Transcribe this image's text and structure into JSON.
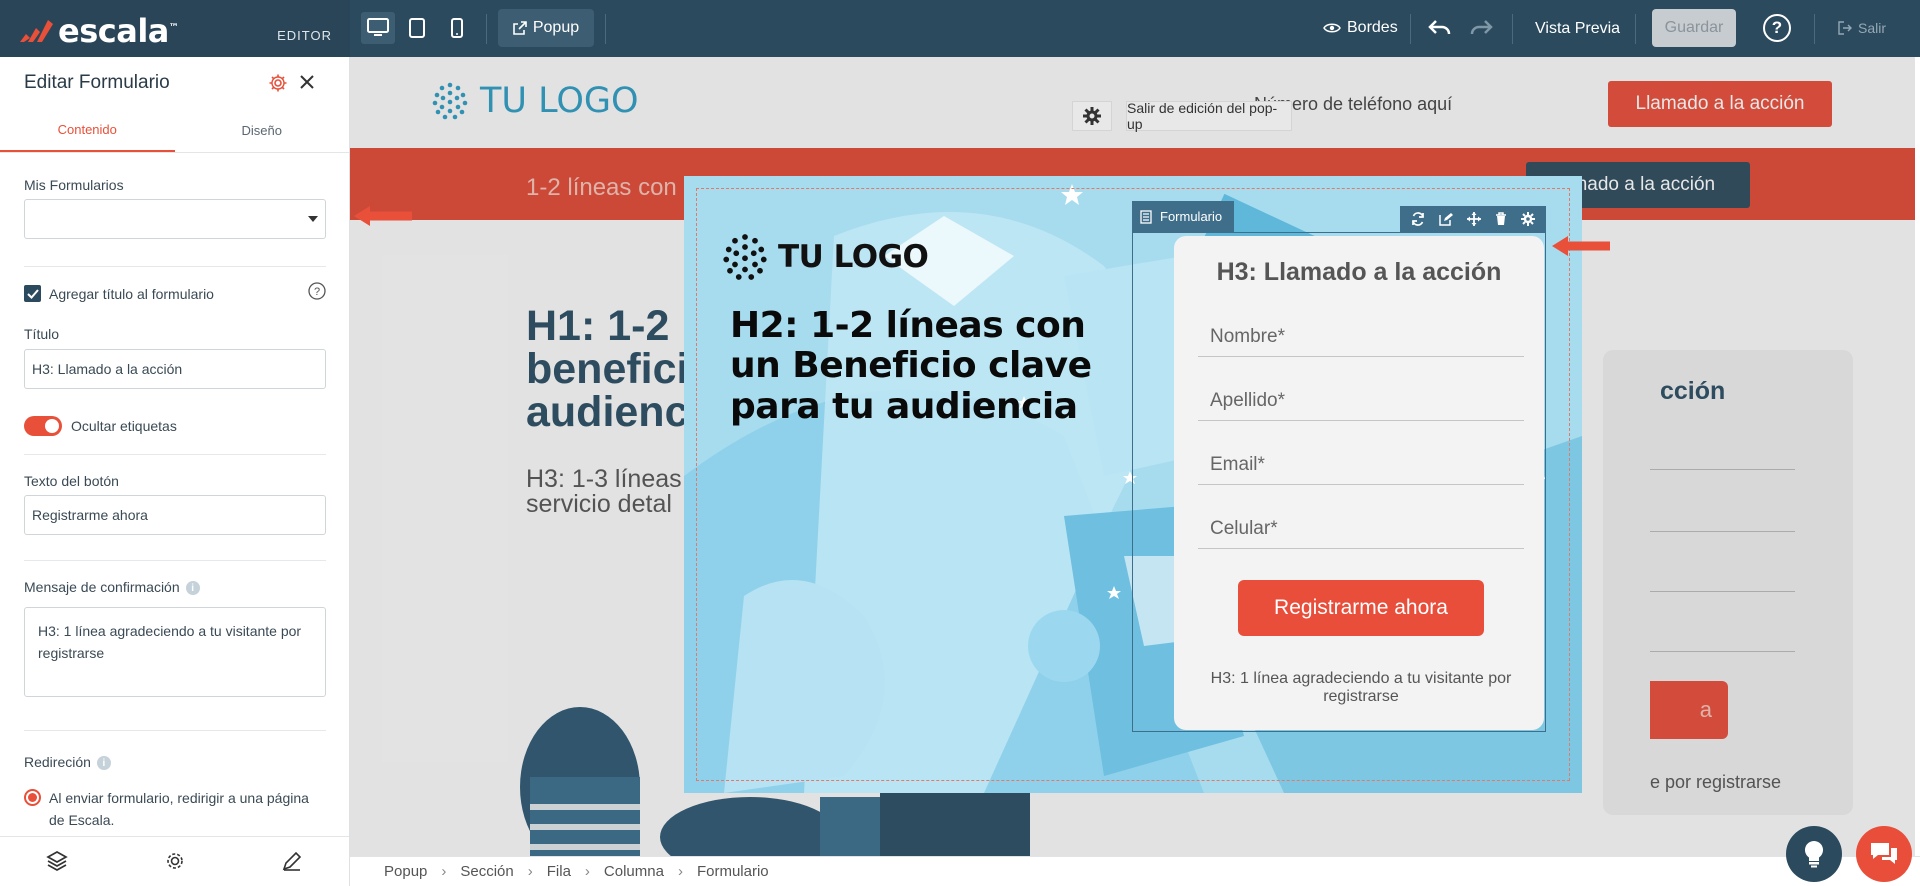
{
  "app": {
    "brand": "escala",
    "brand_tm": "™",
    "mode_label": "EDITOR"
  },
  "toolbar": {
    "popup_label": "Popup",
    "borders_label": "Bordes",
    "preview_label": "Vista Previa",
    "save_label": "Guardar",
    "help_label": "?",
    "exit_label": "Salir"
  },
  "panel": {
    "title": "Editar Formulario",
    "tabs": [
      {
        "label": "Contenido",
        "active": true
      },
      {
        "label": "Diseño",
        "active": false
      }
    ],
    "my_forms_label": "Mis Formularios",
    "my_forms_value": "",
    "add_title_label": "Agregar título al formulario",
    "add_title_checked": true,
    "title_label": "Título",
    "title_value": "H3: Llamado a la acción",
    "hide_labels_label": "Ocultar etiquetas",
    "hide_labels_on": true,
    "button_text_label": "Texto del botón",
    "button_text_value": "Registrarme ahora",
    "confirm_label": "Mensaje de confirmación",
    "confirm_value": "H3: 1 línea agradeciendo a tu visitante por registrarse",
    "redirect_label": "Redireción",
    "redirect_option": "Al enviar formulario, redirigir a una página de Escala.",
    "info_icon": "i"
  },
  "site": {
    "logo": "TU LOGO",
    "phone": "Número de teléfono aquí",
    "cta": "Llamado a la acción",
    "band_text": "1-2 líneas con",
    "band_cta": "amado a la acción",
    "h1": "H1: 1-2 benefici audienc",
    "h3": "H3: 1-3 líneas servicio detal",
    "card_title": "cción",
    "card_btn": "a",
    "card_note": "e por registrarse"
  },
  "popup_controls": {
    "exit_popup_label": "Salir de edición del pop-up"
  },
  "popup": {
    "logo": "TU LOGO",
    "h2": "H2: 1-2 líneas con un Beneficio clave para tu audiencia",
    "form_tag": "Formulario",
    "form_title": "H3: Llamado a la acción",
    "fields": [
      "Nombre*",
      "Apellido*",
      "Email*",
      "Celular*"
    ],
    "button": "Registrarme ahora",
    "note": "H3: 1 línea agradeciendo a tu visitante por registrarse"
  },
  "breadcrumb": [
    "Popup",
    "Sección",
    "Fila",
    "Columna",
    "Formulario"
  ],
  "colors": {
    "accent": "#e8503a",
    "navy": "#2c4a5e",
    "popup_bg": "#a7dcef"
  }
}
